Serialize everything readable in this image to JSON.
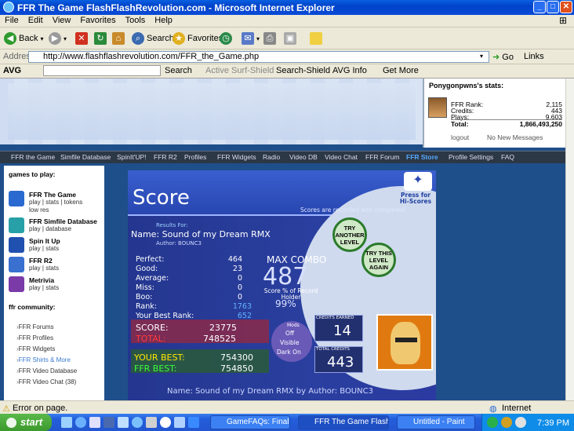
{
  "window": {
    "title": "FFR The Game FlashFlashRevolution.com - Microsoft Internet Explorer"
  },
  "menu": [
    "File",
    "Edit",
    "View",
    "Favorites",
    "Tools",
    "Help"
  ],
  "toolbar": {
    "back": "Back",
    "search": "Search",
    "favorites": "Favorites"
  },
  "address": {
    "label": "Address",
    "url": "http://www.flashflashrevolution.com/FFR_the_Game.php",
    "go": "Go",
    "links": "Links"
  },
  "avgbar": {
    "avg": "AVG",
    "search": "Search",
    "active": "Active Surf-Shield",
    "shield": "Search-Shield",
    "info": "AVG Info",
    "more": "Get More"
  },
  "user_stats": {
    "heading": "Ponygonpwns's stats:",
    "rows": [
      {
        "k": "FFR Rank:",
        "v": "2,115"
      },
      {
        "k": "Credits:",
        "v": "443"
      },
      {
        "k": "Plays:",
        "v": "9,603"
      },
      {
        "k": "Total:",
        "v": "1,866,493,250"
      }
    ],
    "logout": "logout",
    "messages": "No New Messages"
  },
  "nav": [
    "FFR the Game",
    "Simfile Database",
    "SpinIt'UP!",
    "FFR R2",
    "Profiles",
    "FFR Widgets",
    "Radio",
    "Video DB",
    "Video Chat",
    "FFR Forum",
    "FFR Store",
    "Profile Settings",
    "FAQ"
  ],
  "sidebar": {
    "games_heading": "games to play:",
    "games": [
      {
        "title": "FFR The Game",
        "links": "play | stats | tokens",
        "extra": "low res",
        "color": "#2a6ad0"
      },
      {
        "title": "FFR Simfile Database",
        "links": "play | database",
        "color": "#28a0a8"
      },
      {
        "title": "Spin It Up",
        "links": "play | stats",
        "color": "#2050b0"
      },
      {
        "title": "FFR R2",
        "links": "play | stats",
        "color": "#3a70d0"
      },
      {
        "title": "Metrivia",
        "links": "play | stats",
        "color": "#7a3aa8"
      }
    ],
    "community_heading": "ffr community:",
    "community": [
      "FFR Forums",
      "FFR Profiles",
      "FFR Widgets",
      "FFR Shirts & More",
      "FFR Video Database",
      "FFR Video Chat (38)"
    ]
  },
  "game": {
    "title": "Score",
    "press": "Press for Hi-Scores",
    "recorded": "Scores are recorded and compared!",
    "results_for": "Results For:",
    "song_name": "Name: Sound of my Dream RMX",
    "author": "Author: BOUNC3",
    "try_another": "TRY ANOTHER LEVEL",
    "try_again": "TRY THIS LEVEL AGAIN",
    "stats": [
      {
        "k": "Perfect:",
        "v": "464"
      },
      {
        "k": "Good:",
        "v": "23"
      },
      {
        "k": "Average:",
        "v": "0"
      },
      {
        "k": "Miss:",
        "v": "0"
      },
      {
        "k": "Boo:",
        "v": "0"
      },
      {
        "k": "Rank:",
        "v": "1763"
      },
      {
        "k": "Your Best Rank:",
        "v": "652"
      }
    ],
    "max_combo_label": "MAX COMBO",
    "max_combo": "487",
    "record_label": "Score % of Record Holder",
    "record_pct": "99%",
    "score_label": "SCORE:",
    "score": "23775",
    "total_label": "TOTAL:",
    "total": "748525",
    "best_label": "YOUR BEST:",
    "best": "754300",
    "ffr_best_label": "FFR BEST:",
    "ffr_best": "754850",
    "mods_label": "Mods",
    "mods": [
      "Off",
      "Visible",
      "Dark On"
    ],
    "credits_earned_label": "CREDITS EARNED",
    "credits_earned": "14",
    "total_credits_label": "TOTAL CREDITS",
    "total_credits": "443",
    "footer": "Name: Sound of my Dream RMX by Author: BOUNC3"
  },
  "status": {
    "left": "Error on page.",
    "zone": "Internet"
  },
  "taskbar": {
    "start": "start",
    "tasks": [
      "GameFAQs: Final Fan...",
      "FFR The Game FlashF...",
      "Untitled - Paint"
    ],
    "clock": "7:39 PM"
  }
}
